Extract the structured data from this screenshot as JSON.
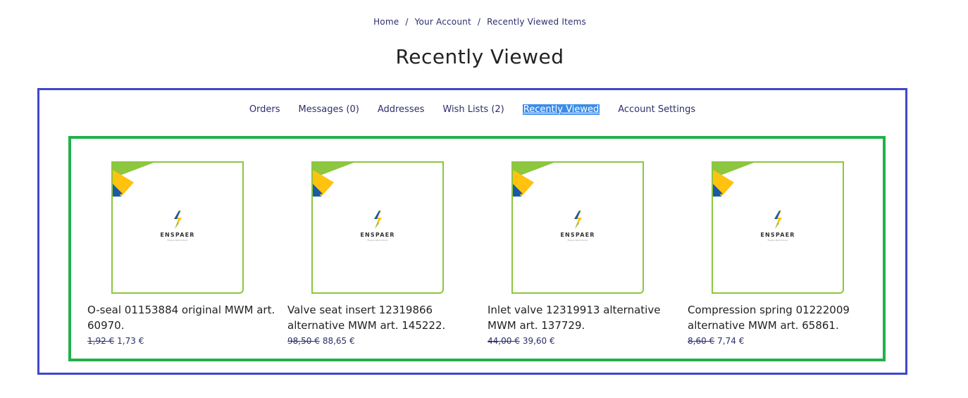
{
  "breadcrumb": {
    "items": [
      "Home",
      "Your Account",
      "Recently Viewed Items"
    ],
    "separator": "/"
  },
  "page": {
    "title": "Recently Viewed"
  },
  "account_nav": {
    "items": [
      "Orders",
      "Messages (0)",
      "Addresses",
      "Wish Lists (2)",
      "Recently Viewed",
      "Account Settings"
    ],
    "active": "Recently Viewed"
  },
  "brand": {
    "logo_text": "ENSPAER",
    "logo_sub": "Engine Parts Direct",
    "colors": {
      "green": "#8dc63f",
      "yellow": "#ffc20e",
      "blue": "#1c5aa6"
    }
  },
  "products": [
    {
      "title": "O-seal 01153884 original MWM art. 60970.",
      "price_old": "1,92 €",
      "price_new": "1,73 €"
    },
    {
      "title": "Valve seat insert 12319866 alternative MWM art. 145222.",
      "price_old": "98,50 €",
      "price_new": "88,65 €"
    },
    {
      "title": "Inlet valve 12319913 alternative MWM art. 137729.",
      "price_old": "44,00 €",
      "price_new": "39,60 €"
    },
    {
      "title": "Compression spring 01222009 alternative MWM art. 65861.",
      "price_old": "8,60 €",
      "price_new": "7,74 €"
    }
  ]
}
